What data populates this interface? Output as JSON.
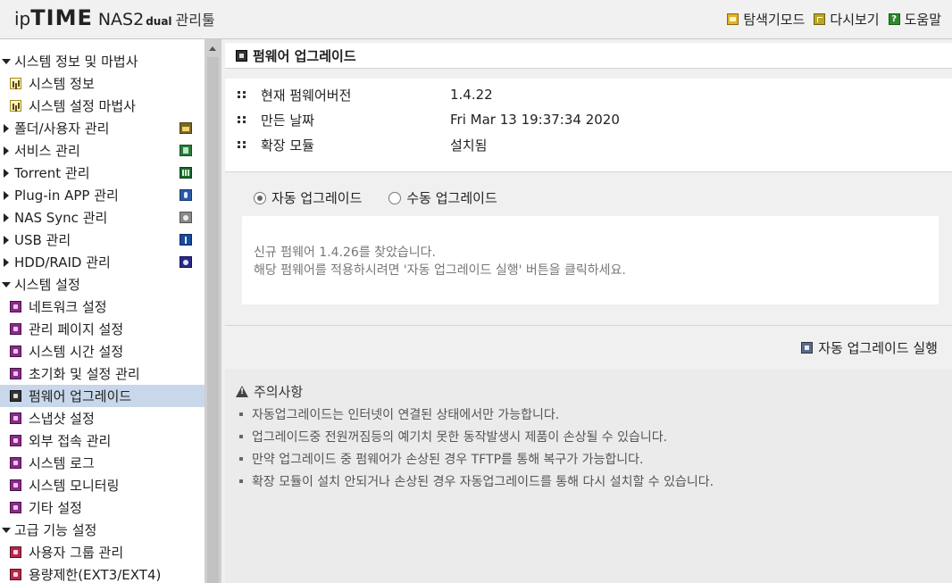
{
  "header": {
    "logo_ip": "ip",
    "logo_time": "TIME",
    "logo_nas": "NAS2",
    "logo_dual": "dual",
    "logo_tool": "관리툴",
    "links": [
      {
        "label": "탐색기모드",
        "icon": "explorer-icon"
      },
      {
        "label": "다시보기",
        "icon": "refresh-icon"
      },
      {
        "label": "도움말",
        "icon": "help-icon"
      }
    ]
  },
  "sidebar": {
    "system_info_group": "시스템 정보 및 마법사",
    "system_info": "시스템 정보",
    "system_wizard": "시스템 설정 마법사",
    "folder_user": "폴더/사용자 관리",
    "service": "서비스 관리",
    "torrent": "Torrent 관리",
    "plugin": "Plug-in APP 관리",
    "nas_sync": "NAS Sync 관리",
    "usb": "USB 관리",
    "hdd_raid": "HDD/RAID 관리",
    "system_settings_group": "시스템 설정",
    "network": "네트워크 설정",
    "admin_page": "관리 페이지 설정",
    "system_time": "시스템 시간 설정",
    "reset": "초기화 및 설정 관리",
    "firmware_upgrade": "펌웨어 업그레이드",
    "snapshot": "스냅샷 설정",
    "external_access": "외부 접속 관리",
    "system_log": "시스템 로그",
    "system_monitor": "시스템 모니터링",
    "other": "기타 설정",
    "advanced_group": "고급 기능 설정",
    "user_group": "사용자 그룹 관리",
    "quota": "용량제한(EXT3/EXT4)"
  },
  "main": {
    "title": "펌웨어 업그레이드",
    "info": [
      {
        "label": "현재 펌웨어버전",
        "value": "1.4.22"
      },
      {
        "label": "만든 날짜",
        "value": "Fri Mar 13 19:37:34 2020"
      },
      {
        "label": "확장 모듈",
        "value": "설치됨"
      }
    ],
    "mode": {
      "auto_label": "자동 업그레이드",
      "manual_label": "수동 업그레이드",
      "selected": "auto"
    },
    "message": {
      "line1": "신규 펌웨어 1.4.26를 찾았습니다.",
      "line2": "해당 펌웨어를 적용하시려면 '자동 업그레이드 실행' 버튼을 클릭하세요."
    },
    "run_button": "자동 업그레이드 실행",
    "notice": {
      "title": "주의사항",
      "items": [
        "자동업그레이드는 인터넷이 연결된 상태에서만 가능합니다.",
        "업그레이드중 전원꺼짐등의 예기치 못한 동작발생시 제품이 손상될 수 있습니다.",
        "만약 업그레이드 중 펌웨어가 손상된 경우 TFTP를 통해 복구가 가능합니다.",
        "확장 모듈이 설치 안되거나 손상된 경우 자동업그레이드를 통해 다시 설치할 수 있습니다."
      ]
    }
  }
}
